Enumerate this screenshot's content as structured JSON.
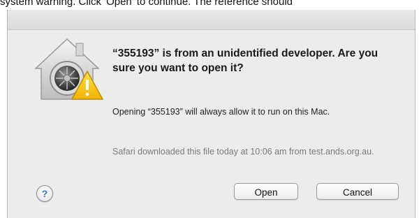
{
  "caption": {
    "text": "system warning. Click 'Open' to continue. The reference should"
  },
  "dialog": {
    "icon": "gatekeeper-security-icon",
    "title": "“355193” is from an unidentified developer. Are you sure you want to open it?",
    "info": "Opening “355193” will always allow it to run on this Mac.",
    "source": "Safari downloaded this file today at 10:06 am from test.ands.org.au.",
    "help_label": "?",
    "buttons": {
      "open": "Open",
      "cancel": "Cancel"
    }
  },
  "colors": {
    "dialog_bg": "#ececec",
    "help_blue": "#3c6fd0",
    "warning_yellow": "#f5c400"
  }
}
